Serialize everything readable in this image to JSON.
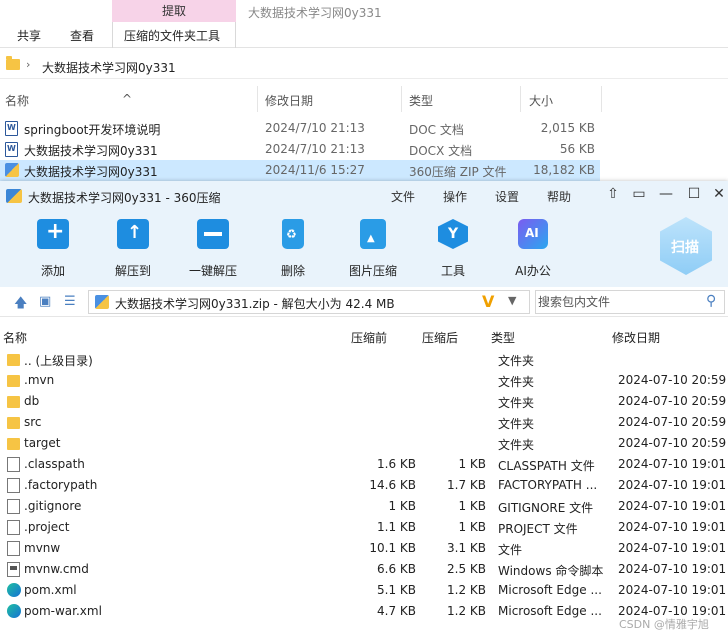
{
  "explorer": {
    "window_title": "大数据技术学习网0y331",
    "context_tab": "提取",
    "ribbon_tabs": [
      "共享",
      "查看",
      "压缩的文件夹工具"
    ],
    "breadcrumb": "大数据技术学习网0y331",
    "columns": {
      "name": "名称",
      "date": "修改日期",
      "type": "类型",
      "size": "大小"
    },
    "rows": [
      {
        "name": "springboot开发环境说明",
        "date": "2024/7/10 21:13",
        "type": "DOC 文档",
        "size": "2,015 KB"
      },
      {
        "name": "大数据技术学习网0y331",
        "date": "2024/7/10 21:13",
        "type": "DOCX 文档",
        "size": "56 KB"
      },
      {
        "name": "大数据技术学习网0y331",
        "date": "2024/11/6 15:27",
        "type": "360压缩 ZIP 文件",
        "size": "18,182 KB"
      }
    ]
  },
  "zip_window": {
    "title": "大数据技术学习网0y331 - 360压缩",
    "menu": [
      "文件",
      "操作",
      "设置",
      "帮助"
    ],
    "tools": [
      "添加",
      "解压到",
      "一键解压",
      "删除",
      "图片压缩",
      "工具",
      "AI办公"
    ],
    "scan_label": "扫描",
    "path_text": "大数据技术学习网0y331.zip - 解包大小为 42.4 MB",
    "search_placeholder": "搜索包内文件",
    "columns": {
      "name": "名称",
      "compressed": "压缩前",
      "after": "压缩后",
      "type": "类型",
      "date": "修改日期"
    },
    "rows": [
      {
        "name": ".. (上级目录)",
        "before": "",
        "after": "",
        "type": "文件夹",
        "date": "",
        "icon": "folder"
      },
      {
        "name": ".mvn",
        "before": "",
        "after": "",
        "type": "文件夹",
        "date": "2024-07-10 20:59",
        "icon": "folder"
      },
      {
        "name": "db",
        "before": "",
        "after": "",
        "type": "文件夹",
        "date": "2024-07-10 20:59",
        "icon": "folder"
      },
      {
        "name": "src",
        "before": "",
        "after": "",
        "type": "文件夹",
        "date": "2024-07-10 20:59",
        "icon": "folder"
      },
      {
        "name": "target",
        "before": "",
        "after": "",
        "type": "文件夹",
        "date": "2024-07-10 20:59",
        "icon": "folder"
      },
      {
        "name": ".classpath",
        "before": "1.6 KB",
        "after": "1 KB",
        "type": "CLASSPATH 文件",
        "date": "2024-07-10 19:01",
        "icon": "file"
      },
      {
        "name": ".factorypath",
        "before": "14.6 KB",
        "after": "1.7 KB",
        "type": "FACTORYPATH ...",
        "date": "2024-07-10 19:01",
        "icon": "file"
      },
      {
        "name": ".gitignore",
        "before": "1 KB",
        "after": "1 KB",
        "type": "GITIGNORE 文件",
        "date": "2024-07-10 19:01",
        "icon": "file"
      },
      {
        "name": ".project",
        "before": "1.1 KB",
        "after": "1 KB",
        "type": "PROJECT 文件",
        "date": "2024-07-10 19:01",
        "icon": "file"
      },
      {
        "name": "mvnw",
        "before": "10.1 KB",
        "after": "3.1 KB",
        "type": "文件",
        "date": "2024-07-10 19:01",
        "icon": "file"
      },
      {
        "name": "mvnw.cmd",
        "before": "6.6 KB",
        "after": "2.5 KB",
        "type": "Windows 命令脚本",
        "date": "2024-07-10 19:01",
        "icon": "cmd"
      },
      {
        "name": "pom.xml",
        "before": "5.1 KB",
        "after": "1.2 KB",
        "type": "Microsoft Edge ...",
        "date": "2024-07-10 19:01",
        "icon": "edge"
      },
      {
        "name": "pom-war.xml",
        "before": "4.7 KB",
        "after": "1.2 KB",
        "type": "Microsoft Edge ...",
        "date": "2024-07-10 19:01",
        "icon": "edge"
      }
    ]
  },
  "watermark": "CSDN @情雅宇旭",
  "colors": {
    "accent": "#1e8de0",
    "selected_row": "#cce8ff",
    "context_tab": "#f7d3e8"
  }
}
